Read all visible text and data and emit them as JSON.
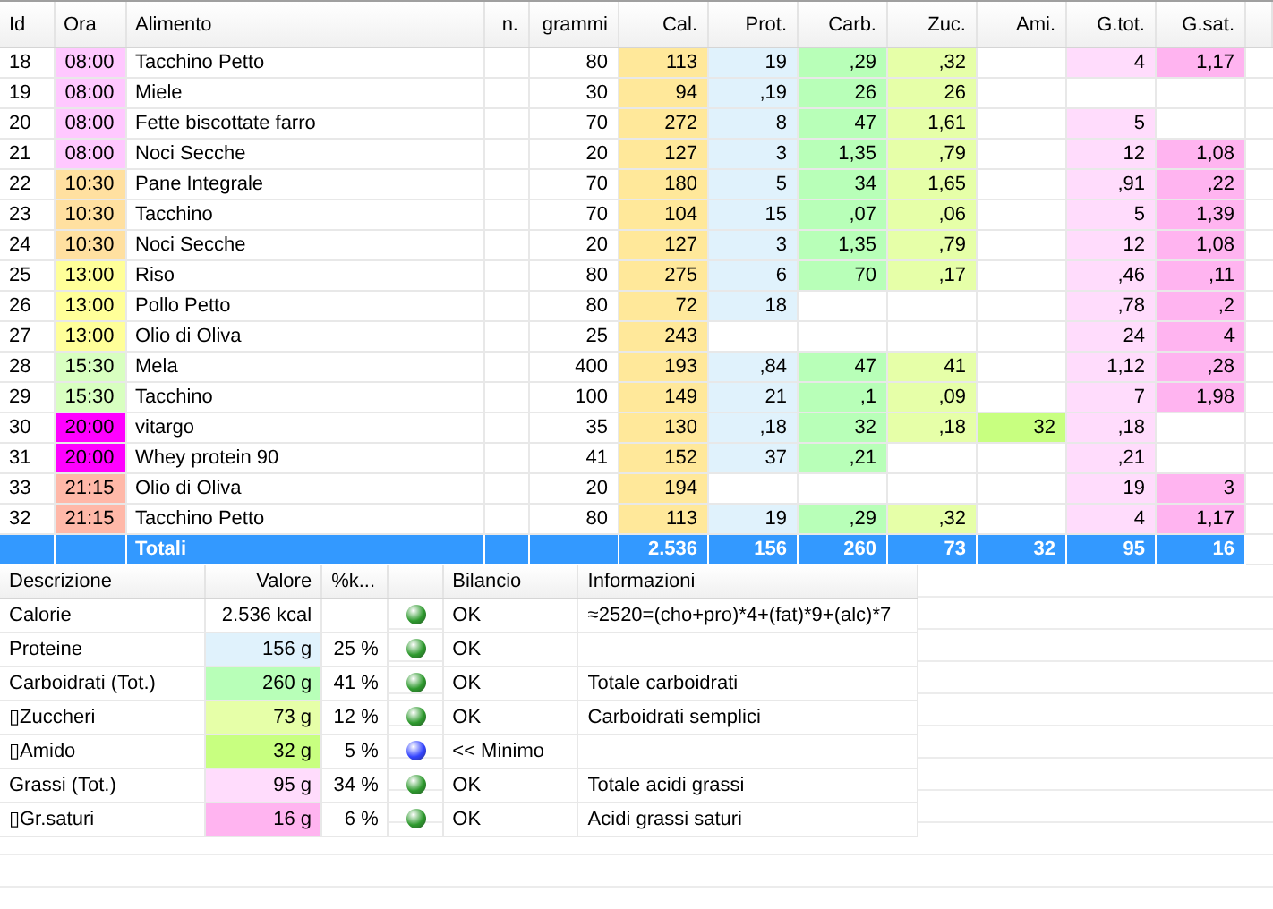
{
  "food_table": {
    "columns": [
      {
        "label": "Id"
      },
      {
        "label": "Ora"
      },
      {
        "label": "Alimento"
      },
      {
        "label": "n."
      },
      {
        "label": "grammi"
      },
      {
        "label": "Cal.",
        "color": "#ffe89a"
      },
      {
        "label": "Prot.",
        "color": "#e0f2fc"
      },
      {
        "label": "Carb.",
        "color": "#b8ffb8"
      },
      {
        "label": "Zuc.",
        "color": "#e6ffa8"
      },
      {
        "label": "Ami.",
        "color": "#c8ff80"
      },
      {
        "label": "G.tot.",
        "color": "#ffdcfc"
      },
      {
        "label": "G.sat.",
        "color": "#ffb4f0"
      }
    ],
    "rows": [
      {
        "id": "18",
        "time": "08:00",
        "color": "#ffc8ff",
        "food": "Tacchino Petto",
        "grams": "80",
        "values": {
          "cal": "113",
          "prot": "19",
          "carb": ",29",
          "zuc": ",32",
          "gtot": "4",
          "gsat": "1,17"
        }
      },
      {
        "id": "19",
        "time": "08:00",
        "color": "#ffc8ff",
        "food": "Miele",
        "grams": "30",
        "values": {
          "cal": "94",
          "prot": ",19",
          "carb": "26",
          "zuc": "26"
        }
      },
      {
        "id": "20",
        "time": "08:00",
        "color": "#ffc8ff",
        "food": "Fette biscottate farro",
        "grams": "70",
        "values": {
          "cal": "272",
          "prot": "8",
          "carb": "47",
          "zuc": "1,61",
          "gtot": "5"
        }
      },
      {
        "id": "21",
        "time": "08:00",
        "color": "#ffc8ff",
        "food": "Noci Secche",
        "grams": "20",
        "values": {
          "cal": "127",
          "prot": "3",
          "carb": "1,35",
          "zuc": ",79",
          "gtot": "12",
          "gsat": "1,08"
        }
      },
      {
        "id": "22",
        "time": "10:30",
        "color": "#ffe0a0",
        "food": "Pane Integrale",
        "grams": "70",
        "values": {
          "cal": "180",
          "prot": "5",
          "carb": "34",
          "zuc": "1,65",
          "gtot": ",91",
          "gsat": ",22"
        }
      },
      {
        "id": "23",
        "time": "10:30",
        "color": "#ffe0a0",
        "food": "Tacchino",
        "grams": "70",
        "values": {
          "cal": "104",
          "prot": "15",
          "carb": ",07",
          "zuc": ",06",
          "gtot": "5",
          "gsat": "1,39"
        }
      },
      {
        "id": "24",
        "time": "10:30",
        "color": "#ffe0a0",
        "food": "Noci Secche",
        "grams": "20",
        "values": {
          "cal": "127",
          "prot": "3",
          "carb": "1,35",
          "zuc": ",79",
          "gtot": "12",
          "gsat": "1,08"
        }
      },
      {
        "id": "25",
        "time": "13:00",
        "color": "#ffff99",
        "food": "Riso",
        "grams": "80",
        "values": {
          "cal": "275",
          "prot": "6",
          "carb": "70",
          "zuc": ",17",
          "gtot": ",46",
          "gsat": ",11"
        }
      },
      {
        "id": "26",
        "time": "13:00",
        "color": "#ffff99",
        "food": "Pollo Petto",
        "grams": "80",
        "values": {
          "cal": "72",
          "prot": "18",
          "gtot": ",78",
          "gsat": ",2"
        }
      },
      {
        "id": "27",
        "time": "13:00",
        "color": "#ffff99",
        "food": "Olio di Oliva",
        "grams": "25",
        "values": {
          "cal": "243",
          "gtot": "24",
          "gsat": "4"
        }
      },
      {
        "id": "28",
        "time": "15:30",
        "color": "#d8ffc0",
        "food": "Mela",
        "grams": "400",
        "values": {
          "cal": "193",
          "prot": ",84",
          "carb": "47",
          "zuc": "41",
          "gtot": "1,12",
          "gsat": ",28"
        }
      },
      {
        "id": "29",
        "time": "15:30",
        "color": "#d8ffc0",
        "food": "Tacchino",
        "grams": "100",
        "values": {
          "cal": "149",
          "prot": "21",
          "carb": ",1",
          "zuc": ",09",
          "gtot": "7",
          "gsat": "1,98"
        }
      },
      {
        "id": "30",
        "time": "20:00",
        "color": "#ff00ff",
        "food": "vitargo",
        "grams": "35",
        "values": {
          "cal": "130",
          "prot": ",18",
          "carb": "32",
          "zuc": ",18",
          "ami": "32",
          "gtot": ",18"
        }
      },
      {
        "id": "31",
        "time": "20:00",
        "color": "#ff00ff",
        "food": "Whey protein 90",
        "grams": "41",
        "values": {
          "cal": "152",
          "prot": "37",
          "carb": ",21",
          "gtot": ",21"
        }
      },
      {
        "id": "33",
        "time": "21:15",
        "color": "#ffb8a8",
        "food": "Olio di Oliva",
        "grams": "20",
        "values": {
          "cal": "194",
          "gtot": "19",
          "gsat": "3"
        }
      },
      {
        "id": "32",
        "time": "21:15",
        "color": "#ffb8a8",
        "food": "Tacchino Petto",
        "grams": "80",
        "values": {
          "cal": "113",
          "prot": "19",
          "carb": ",29",
          "zuc": ",32",
          "gtot": "4",
          "gsat": "1,17"
        }
      }
    ],
    "totals": {
      "label": "Totali",
      "values": [
        "2.536",
        "156",
        "260",
        "73",
        "32",
        "95",
        "16"
      ]
    }
  },
  "summary_table": {
    "columns": [
      "Descrizione",
      "Valore",
      "%k...",
      "Bilancio",
      "Informazioni"
    ],
    "rows": [
      {
        "description": "Calorie",
        "value": "2.536 kcal",
        "kind": "ok",
        "balance": "OK",
        "info": "≈2520=(cho+pro)*4+(fat)*9+(alc)*7"
      },
      {
        "description": "Proteine",
        "value": "156 g",
        "color": "#e0f2fc",
        "percent": "25 %",
        "kind": "ok",
        "balance": "OK"
      },
      {
        "description": "Carboidrati (Tot.)",
        "value": "260 g",
        "color": "#b8ffb8",
        "percent": "41 %",
        "kind": "ok",
        "balance": "OK",
        "info": "Totale carboidrati"
      },
      {
        "description": "▯Zuccheri",
        "value": "73 g",
        "color": "#e6ffa8",
        "percent": "12 %",
        "kind": "ok",
        "balance": "OK",
        "info": "Carboidrati semplici"
      },
      {
        "description": "▯Amido",
        "value": "32 g",
        "color": "#c8ff80",
        "percent": "5 %",
        "kind": "low",
        "balance": "<< Minimo"
      },
      {
        "description": "Grassi (Tot.)",
        "value": "95 g",
        "color": "#ffdcfc",
        "percent": "34 %",
        "kind": "ok",
        "balance": "OK",
        "info": "Totale acidi grassi"
      },
      {
        "description": "▯Gr.saturi",
        "value": "16 g",
        "color": "#ffb4f0",
        "percent": "6 %",
        "kind": "ok",
        "balance": "OK",
        "info": "Acidi grassi saturi"
      }
    ]
  }
}
